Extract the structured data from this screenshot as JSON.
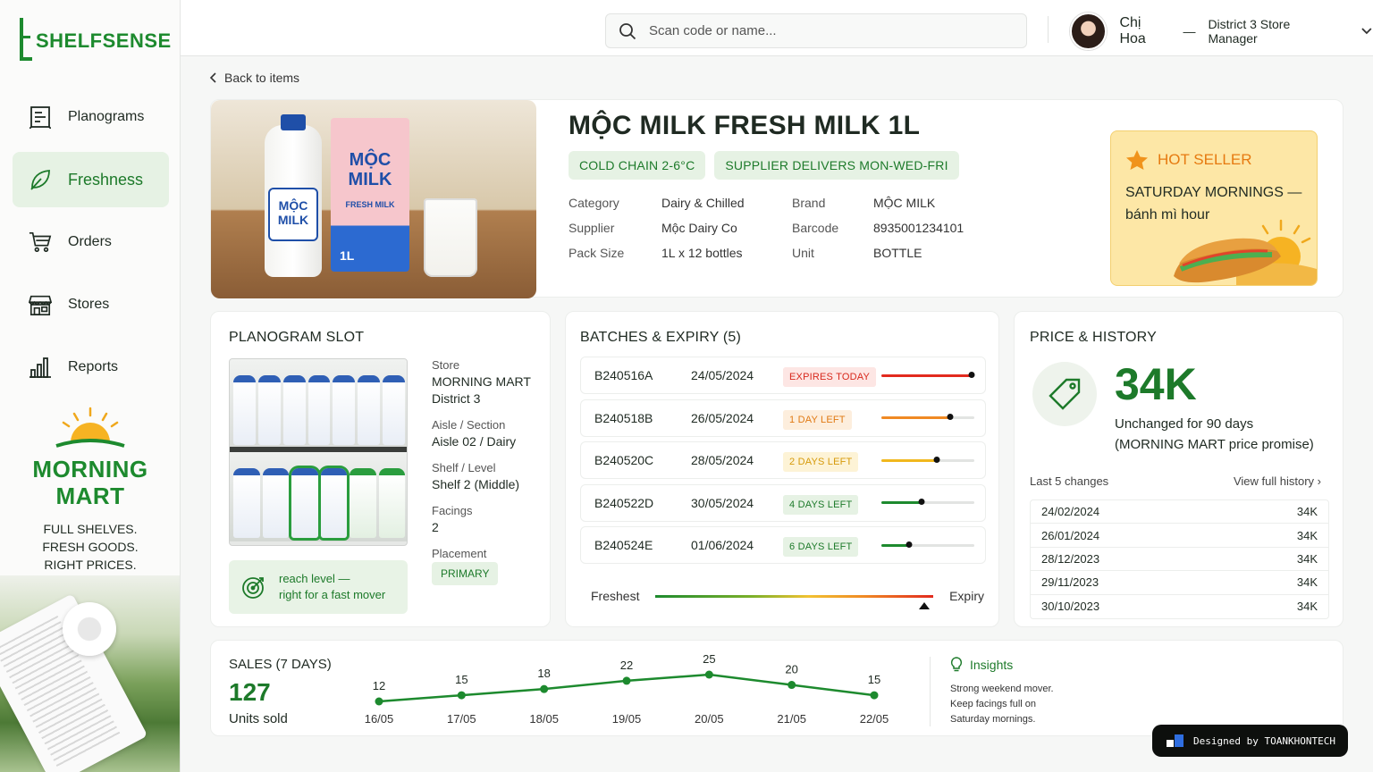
{
  "app": {
    "name": "SHELFSENSE"
  },
  "sidebar": {
    "items": [
      {
        "label": "Planograms",
        "icon": "planogram-icon"
      },
      {
        "label": "Freshness",
        "icon": "leaf-icon",
        "active": true
      },
      {
        "label": "Orders",
        "icon": "cart-icon"
      },
      {
        "label": "Stores",
        "icon": "store-icon"
      },
      {
        "label": "Reports",
        "icon": "bar-chart-icon"
      }
    ],
    "brand": {
      "name_line1": "MORNING",
      "name_line2": "MART",
      "tagline1": "FULL SHELVES.",
      "tagline2": "FRESH GOODS.",
      "tagline3": "RIGHT PRICES."
    }
  },
  "header": {
    "search_placeholder": "Scan code or name...",
    "user_name": "Chị Hoa",
    "user_sep": "—",
    "user_role": "District 3 Store Manager"
  },
  "back_label": "Back to items",
  "product": {
    "title": "MỘC MILK  FRESH MILK 1L",
    "chips": [
      "COLD CHAIN 2-6°C",
      "SUPPLIER DELIVERS MON-WED-FRI"
    ],
    "image_labels": {
      "bottle": "MỘC MILK",
      "carton": "MỘC MILK",
      "carton_sub": "FRESH MILK",
      "size": "1L"
    },
    "meta": [
      {
        "k": "Category",
        "v": "Dairy & Chilled",
        "k2": "Brand",
        "v2": "MỘC MILK"
      },
      {
        "k": "Supplier",
        "v": "Mộc Dairy Co",
        "k2": "Barcode",
        "v2": "8935001234101"
      },
      {
        "k": "Pack Size",
        "v": "1L x 12 bottles",
        "k2": "Unit",
        "v2": "BOTTLE"
      }
    ],
    "hot": {
      "label": "HOT SELLER",
      "line1": "SATURDAY MORNINGS —",
      "line2": "bánh mì hour"
    }
  },
  "planogram": {
    "title": "PLANOGRAM SLOT",
    "store_k": "Store",
    "store_v1": "MORNING MART",
    "store_v2": "District 3",
    "aisle_k": "Aisle / Section",
    "aisle_v": "Aisle 02 / Dairy",
    "shelf_k": "Shelf / Level",
    "shelf_v": "Shelf 2 (Middle)",
    "facings_k": "Facings",
    "facings_v": "2",
    "placement_k": "Placement",
    "placement_v": "PRIMARY",
    "reach_line1": "reach level —",
    "reach_line2": "right for a fast mover"
  },
  "batches": {
    "title": "BATCHES & EXPIRY (5)",
    "rows": [
      {
        "id": "B240516A",
        "date": "24/05/2024",
        "badge": "EXPIRES TODAY",
        "level": 0.97,
        "color": "#e22a1e",
        "bg": "#fde6e4",
        "fg": "#d8281c"
      },
      {
        "id": "B240518B",
        "date": "26/05/2024",
        "badge": "1 DAY LEFT",
        "level": 0.74,
        "color": "#f08a24",
        "bg": "#fdeedd",
        "fg": "#e07a14"
      },
      {
        "id": "B240520C",
        "date": "28/05/2024",
        "badge": "2 DAYS LEFT",
        "level": 0.6,
        "color": "#f1b81d",
        "bg": "#fdf3d6",
        "fg": "#d69a0a"
      },
      {
        "id": "B240522D",
        "date": "30/05/2024",
        "badge": "4 DAYS LEFT",
        "level": 0.43,
        "color": "#1d8a2e",
        "bg": "#e6f2e4",
        "fg": "#1d7a2a"
      },
      {
        "id": "B240524E",
        "date": "01/06/2024",
        "badge": "6 DAYS LEFT",
        "level": 0.3,
        "color": "#1d8a2e",
        "bg": "#e6f2e4",
        "fg": "#1d7a2a"
      }
    ],
    "legend_left": "Freshest",
    "legend_right": "Expiry"
  },
  "price": {
    "title": "PRICE & HISTORY",
    "value": "34K",
    "note1": "Unchanged for 90 days",
    "note2": "(MORNING MART price promise)",
    "history_label": "Last 5 changes",
    "history_link": "View full history",
    "history": [
      {
        "date": "24/02/2024",
        "price": "34K"
      },
      {
        "date": "26/01/2024",
        "price": "34K"
      },
      {
        "date": "28/12/2023",
        "price": "34K"
      },
      {
        "date": "29/11/2023",
        "price": "34K"
      },
      {
        "date": "30/10/2023",
        "price": "34K"
      }
    ]
  },
  "sales": {
    "title": "SALES (7 DAYS)",
    "total": "127",
    "unit": "Units sold",
    "insights_title": "Insights",
    "insights_lines": [
      "Strong weekend mover.",
      "Keep facings full on",
      "Saturday mornings."
    ]
  },
  "chart_data": {
    "type": "line",
    "categories": [
      "16/05",
      "17/05",
      "18/05",
      "19/05",
      "20/05",
      "21/05",
      "22/05"
    ],
    "values": [
      12,
      15,
      18,
      22,
      25,
      20,
      15
    ],
    "color": "#1d8a2e",
    "grid": false,
    "title": "SALES (7 DAYS)"
  },
  "footer_badge": "Designed by TOANKHONTECH"
}
